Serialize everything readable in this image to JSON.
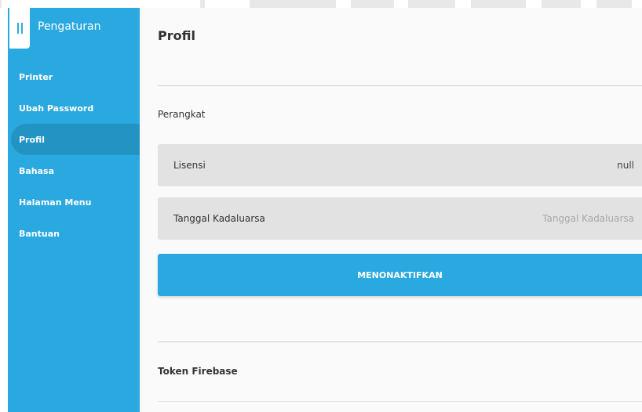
{
  "sidebar": {
    "title": "Pengaturan",
    "toggle_icon": "pause-icon",
    "items": [
      {
        "label": "Printer",
        "active": false
      },
      {
        "label": "Ubah Password",
        "active": false
      },
      {
        "label": "Profil",
        "active": true
      },
      {
        "label": "Bahasa",
        "active": false
      },
      {
        "label": "Halaman Menu",
        "active": false
      },
      {
        "label": "Bantuan",
        "active": false
      }
    ]
  },
  "main": {
    "title": "Profil",
    "section_device": "Perangkat",
    "license": {
      "label": "Lisensi",
      "value": "null"
    },
    "expiry": {
      "label": "Tanggal Kadaluarsa",
      "placeholder": "Tanggal Kadaluarsa"
    },
    "deactivate_button": "MENONAKTIFKAN",
    "section_token": "Token Firebase"
  },
  "colors": {
    "accent": "#2aa8e0",
    "sidebar_active": "#2393c4",
    "field_bg": "#e2e2e2",
    "page_bg": "#fafafa"
  }
}
